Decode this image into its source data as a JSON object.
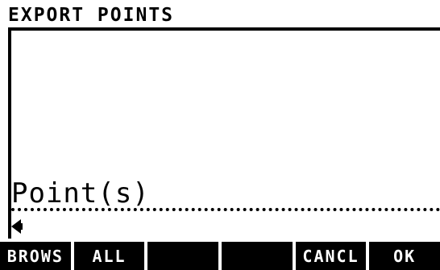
{
  "header": {
    "title": "EXPORT POINTS"
  },
  "field": {
    "label": "Point(s)"
  },
  "softkeys": [
    {
      "label": "BROWS"
    },
    {
      "label": "ALL"
    },
    {
      "label": ""
    },
    {
      "label": ""
    },
    {
      "label": "CANCL"
    },
    {
      "label": "OK"
    }
  ],
  "colors": {
    "foreground": "#000000",
    "background": "#ffffff"
  }
}
